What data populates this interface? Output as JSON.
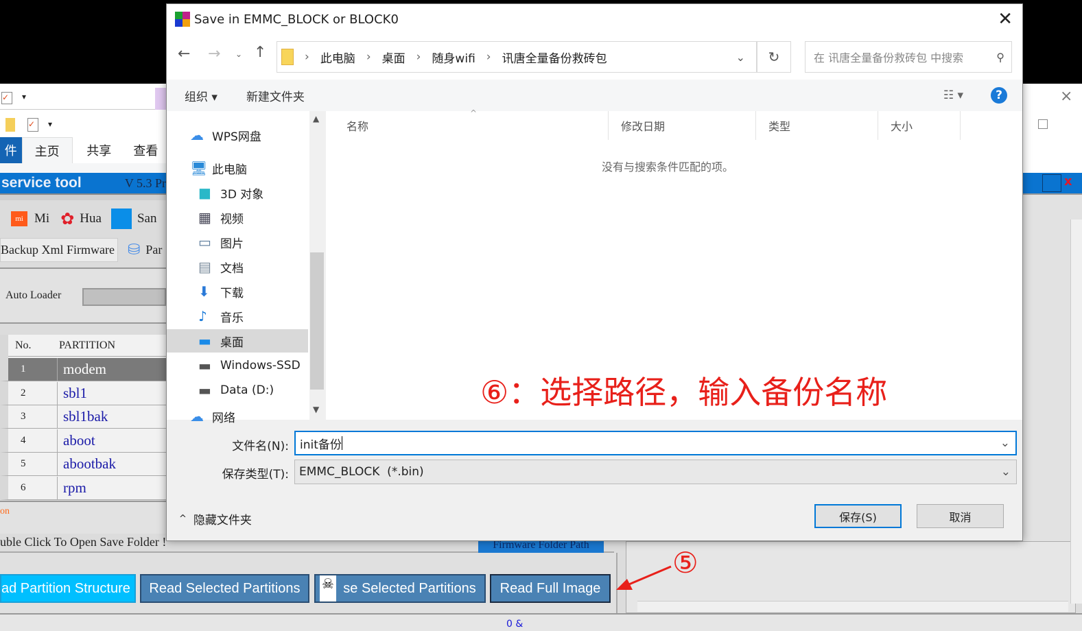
{
  "background_app": {
    "ribbon_tabs": [
      "件",
      "主页",
      "共享",
      "查看"
    ],
    "title_bar": "service tool",
    "version": "V 5.3 Pr",
    "brand_tabs": [
      "Mi",
      "Hua",
      "San"
    ],
    "sub_tabs": [
      "Backup Xml Firmware",
      "Par"
    ],
    "auto_loader_label": "Auto Loader",
    "table": {
      "headers": [
        "No.",
        "PARTITION"
      ],
      "rows": [
        {
          "no": "1",
          "name": "modem"
        },
        {
          "no": "2",
          "name": "sbl1"
        },
        {
          "no": "3",
          "name": "sbl1bak"
        },
        {
          "no": "4",
          "name": "aboot"
        },
        {
          "no": "5",
          "name": "abootbak"
        },
        {
          "no": "6",
          "name": "rpm"
        }
      ],
      "selected_row": 0
    },
    "status_orange": "on",
    "save_folder_hint": "uble Click To Open Save Folder !",
    "firmware_folder_button": "Firmware Folder Path",
    "buttons": [
      "ad Partition Structure",
      "Read Selected Partitions",
      "se Selected Partitions",
      "Read Full Image"
    ],
    "status_bar": "0 &"
  },
  "dialog": {
    "title": "Save in EMMC_BLOCK or BLOCK0",
    "breadcrumb": [
      "此电脑",
      "桌面",
      "随身wifi",
      "讯唐全量备份救砖包"
    ],
    "search_placeholder": "在 讯唐全量备份救砖包 中搜索",
    "toolbar": {
      "organize": "组织",
      "new_folder": "新建文件夹"
    },
    "nav": [
      {
        "label": "WPS网盘",
        "icon": "cloud-icon"
      },
      {
        "label": "此电脑",
        "icon": "computer-icon"
      },
      {
        "label": "3D 对象",
        "icon": "cube-icon"
      },
      {
        "label": "视频",
        "icon": "video-icon"
      },
      {
        "label": "图片",
        "icon": "picture-icon"
      },
      {
        "label": "文档",
        "icon": "document-icon"
      },
      {
        "label": "下载",
        "icon": "download-icon"
      },
      {
        "label": "音乐",
        "icon": "music-icon"
      },
      {
        "label": "桌面",
        "icon": "desktop-icon"
      },
      {
        "label": "Windows-SSD",
        "icon": "drive-icon"
      },
      {
        "label": "Data (D:)",
        "icon": "drive-icon"
      },
      {
        "label": "网络",
        "icon": "network-icon"
      }
    ],
    "nav_selected": "桌面",
    "columns": [
      "名称",
      "修改日期",
      "类型",
      "大小"
    ],
    "empty_message": "没有与搜索条件匹配的项。",
    "filename_label": "文件名(N):",
    "filename_value": "init备份",
    "filetype_label": "保存类型(T):",
    "filetype_value": "EMMC_BLOCK  (*.bin)",
    "hide_folders": "隐藏文件夹",
    "save_button": "保存(S)",
    "cancel_button": "取消"
  },
  "annotations": {
    "step6": "⑥：选择路径，输入备份名称",
    "step5": "⑤",
    "color": "#e8201a"
  },
  "colors": {
    "accent_blue": "#0078d7",
    "app_blue": "#0a74d0",
    "button_blue": "#4a82b4"
  }
}
